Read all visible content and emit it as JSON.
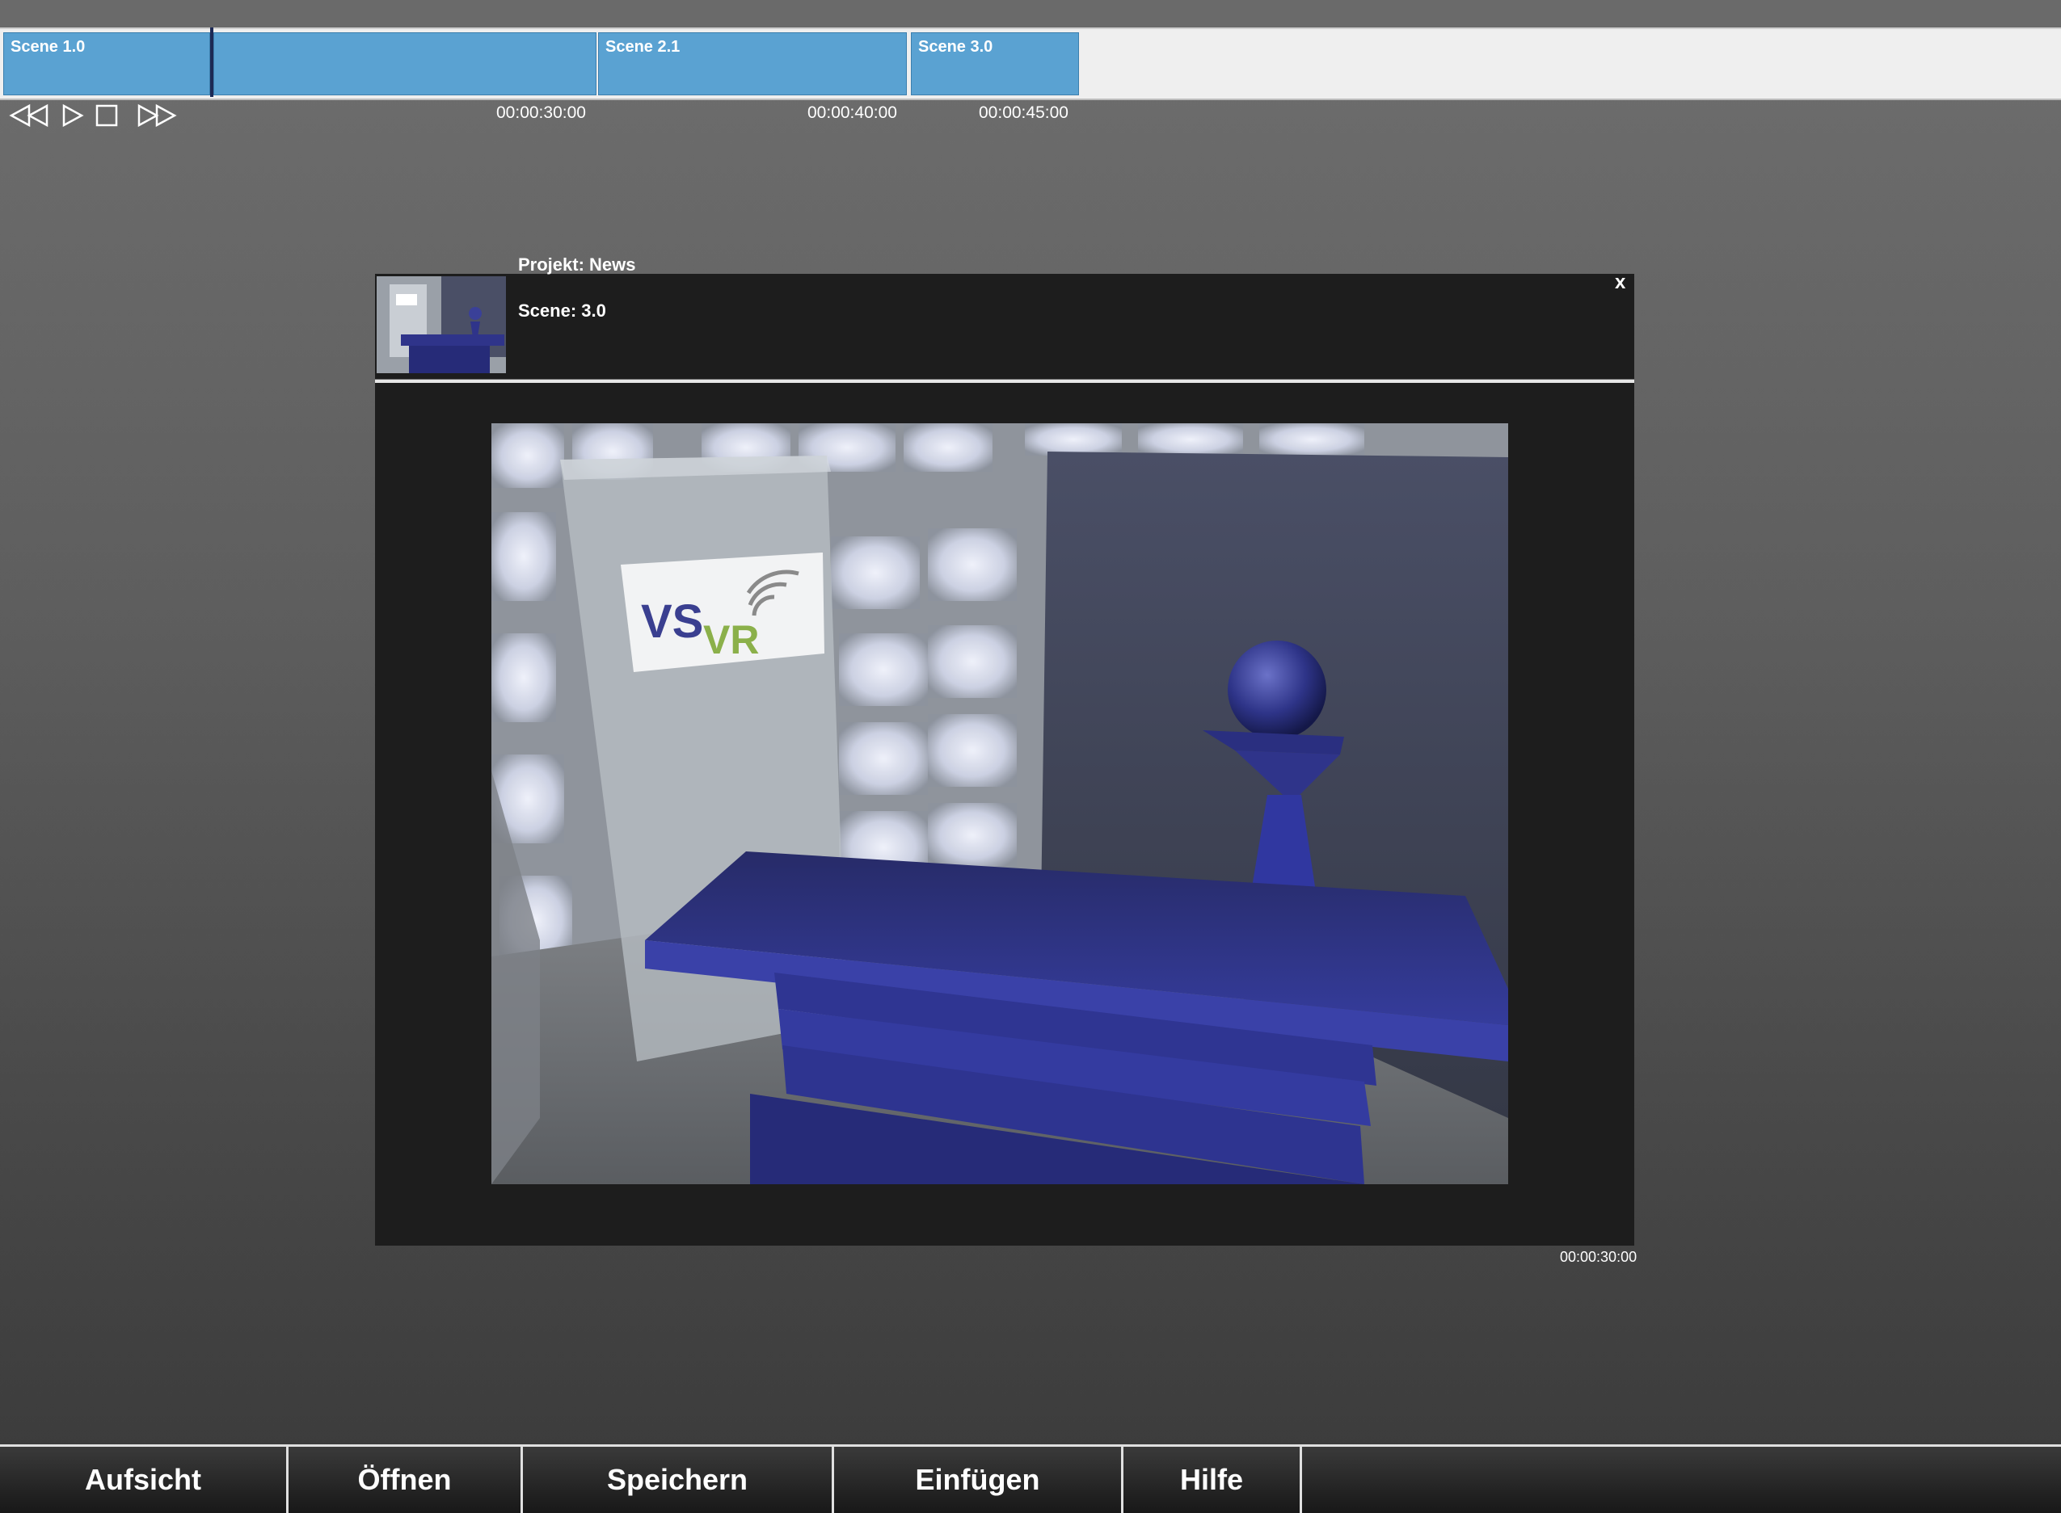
{
  "timeline": {
    "clips": [
      {
        "label": "Scene 1.0"
      },
      {
        "label": ""
      },
      {
        "label": "Scene 2.1"
      },
      {
        "label": "Scene 3.0"
      }
    ],
    "time_marks": [
      "00:00:30:00",
      "00:00:40:00",
      "00:00:45:00"
    ]
  },
  "controls": {
    "icons": [
      "rewind-icon",
      "play-icon",
      "stop-icon",
      "fast-forward-icon"
    ]
  },
  "panel": {
    "project": "Projekt: News",
    "scene": "Scene:  3.0",
    "close": "x",
    "timecode": "00:00:30:00"
  },
  "viewport": {
    "logo_text_vs": "VS",
    "logo_text_vr": "VR"
  },
  "bottom_tabs": [
    {
      "label": "Aufsicht"
    },
    {
      "label": "Öffnen"
    },
    {
      "label": "Speichern"
    },
    {
      "label": "Einfügen"
    },
    {
      "label": "Hilfe"
    }
  ],
  "colors": {
    "clip": "#5aa2d2",
    "playhead": "#1d2a55",
    "panel": "#1d1d1d",
    "set_blue": "#2f348a",
    "logo_green": "#8bb04a"
  }
}
